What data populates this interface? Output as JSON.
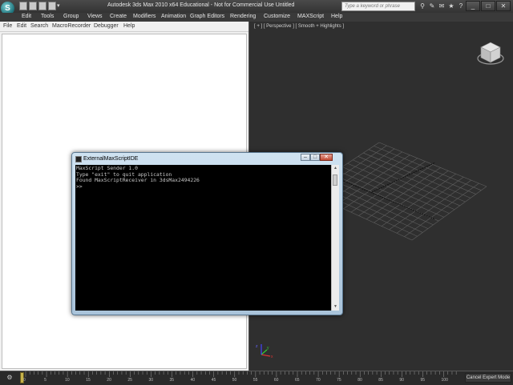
{
  "app": {
    "logo_letter": "S",
    "title": "Autodesk 3ds Max  2010 x64    Educational - Not for Commercial Use    Untitled",
    "help_search_placeholder": "Type a keyword or phrase",
    "window_controls": [
      "_",
      "□",
      "✕"
    ]
  },
  "menubar": [
    "Edit",
    "Tools",
    "Group",
    "Views",
    "Create",
    "Modifiers",
    "Animation",
    "Graph Editors",
    "Rendering",
    "Customize",
    "MAXScript",
    "Help"
  ],
  "editor": {
    "menu": [
      "File",
      "Edit",
      "Search",
      "MacroRecorder",
      "Debugger",
      "Help"
    ]
  },
  "viewport": {
    "label": "[ + ] [ Perspective ] [ Smooth + Highlights ]",
    "axis_labels": [
      "x",
      "y",
      "z"
    ]
  },
  "console": {
    "title": "ExternalMaxScriptIDE",
    "lines": [
      "MaxScript Sender 1.0",
      "Type \"exit\" to quit application",
      "Found MaxScriptReceiver in 3dsMax2494226",
      ">>"
    ],
    "controls": [
      "–",
      "□",
      "✕"
    ],
    "scroll_up": "▲",
    "scroll_down": "▼"
  },
  "timeline": {
    "ticks": [
      "0",
      "5",
      "10",
      "15",
      "20",
      "25",
      "30",
      "35",
      "40",
      "45",
      "50",
      "55",
      "60",
      "65",
      "70",
      "75",
      "80",
      "85",
      "90",
      "95",
      "100"
    ],
    "expert_mode_label": "Cancel Expert Mode"
  },
  "colors": {
    "ui_dark": "#2b2b2b",
    "grid": "#5f5f5f",
    "console_bg": "#000000",
    "time_marker": "#c7b34b"
  }
}
